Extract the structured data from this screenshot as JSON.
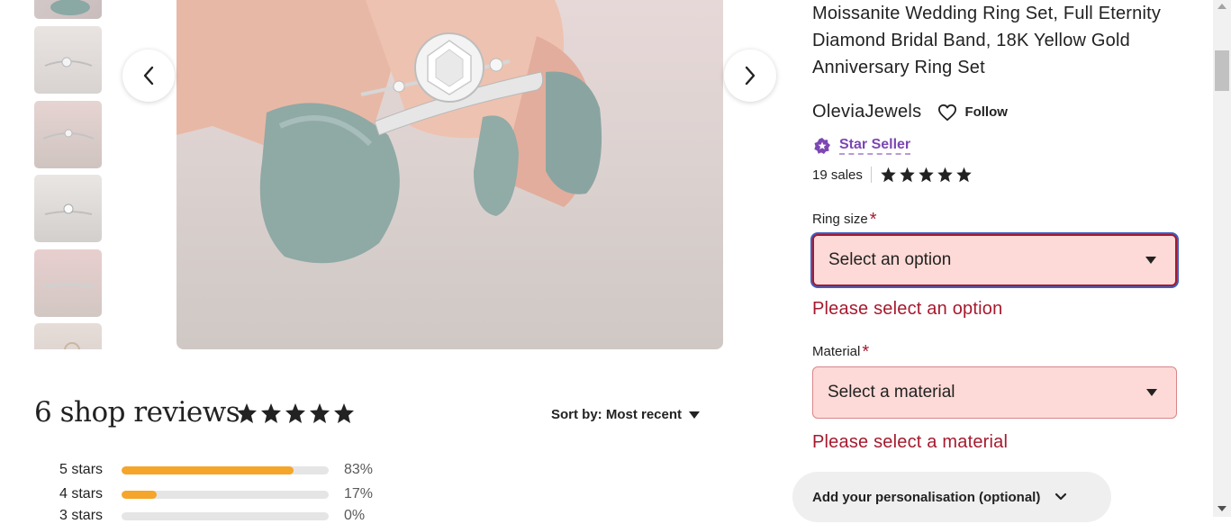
{
  "listing": {
    "title": "Moissanite Wedding Ring Set, Full Eternity Diamond Bridal Band, 18K Yellow Gold Anniversary Ring Set",
    "shop_name": "OleviaJewels",
    "follow_label": "Follow",
    "star_seller_label": "Star Seller",
    "sales_text": "19 sales",
    "rating_stars": 5
  },
  "gallery": {
    "prev_icon": "chevron-left-icon",
    "next_icon": "chevron-right-icon",
    "thumbnail_count": 6
  },
  "options": {
    "ring_size": {
      "label": "Ring size",
      "required_mark": "*",
      "placeholder": "Select an option",
      "error": "Please select an option"
    },
    "material": {
      "label": "Material",
      "required_mark": "*",
      "placeholder": "Select a material",
      "error": "Please select a material"
    },
    "personalisation_label": "Add your personalisation (optional)"
  },
  "reviews": {
    "title": "6 shop reviews",
    "stars": 5,
    "sort_label": "Sort by: Most recent",
    "breakdown": [
      {
        "label": "5 stars",
        "percent": 83,
        "percent_text": "83%"
      },
      {
        "label": "4 stars",
        "percent": 17,
        "percent_text": "17%"
      },
      {
        "label": "3 stars",
        "percent": 0,
        "percent_text": "0%"
      }
    ]
  },
  "colors": {
    "accent_error": "#a61a2e",
    "star_seller_purple": "#7c47b3",
    "rating_bar": "#f5a52a",
    "select_bg": "#fddad7"
  }
}
